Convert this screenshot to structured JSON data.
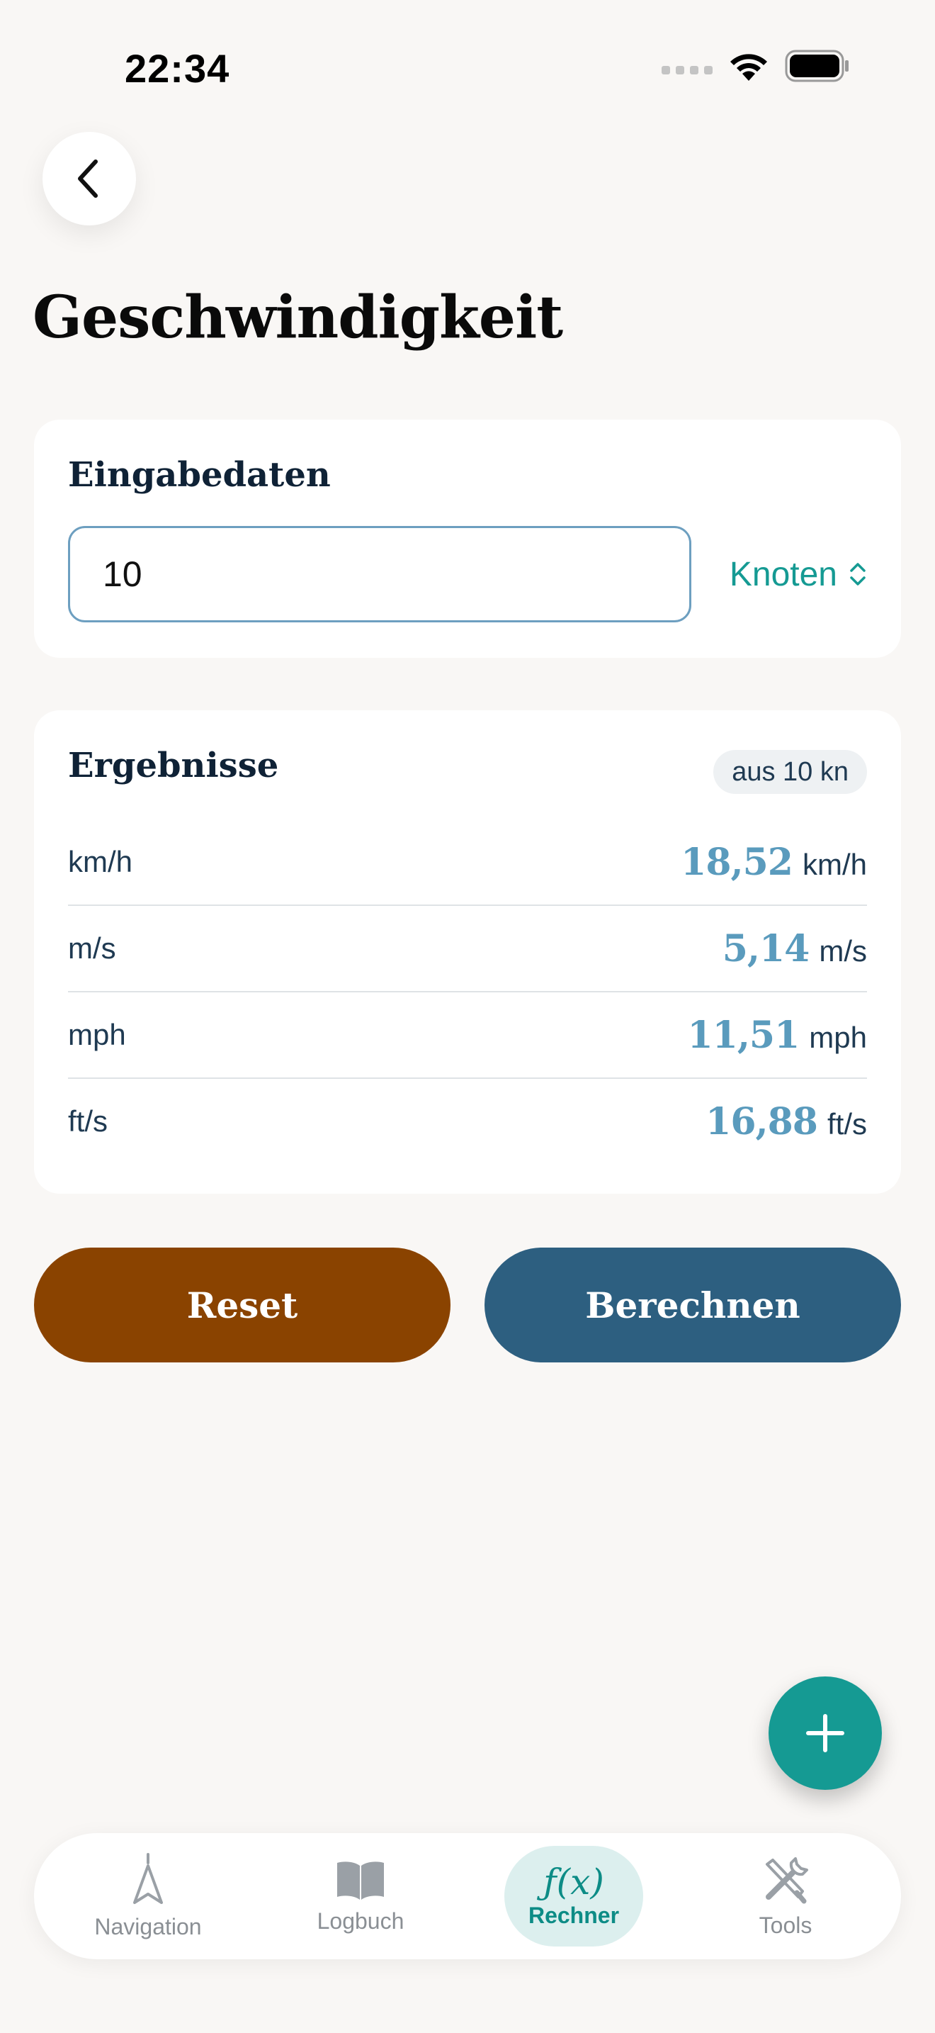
{
  "status_bar": {
    "time": "22:34"
  },
  "page": {
    "title": "Geschwindigkeit"
  },
  "input_card": {
    "heading": "Eingabedaten",
    "value": "10",
    "unit": "Knoten"
  },
  "results_card": {
    "heading": "Ergebnisse",
    "source_badge": "aus 10 kn",
    "rows": [
      {
        "label": "km/h",
        "value": "18,52",
        "unit": "km/h"
      },
      {
        "label": "m/s",
        "value": "5,14",
        "unit": "m/s"
      },
      {
        "label": "mph",
        "value": "11,51",
        "unit": "mph"
      },
      {
        "label": "ft/s",
        "value": "16,88",
        "unit": "ft/s"
      }
    ]
  },
  "actions": {
    "reset_label": "Reset",
    "calculate_label": "Berechnen"
  },
  "tab_bar": {
    "items": [
      {
        "label": "Navigation",
        "icon": "compass-arrow-icon"
      },
      {
        "label": "Logbuch",
        "icon": "book-icon"
      },
      {
        "label": "Rechner",
        "icon": "function-icon",
        "glyph": "ƒ(x)",
        "active": true
      },
      {
        "label": "Tools",
        "icon": "tools-icon"
      }
    ]
  },
  "colors": {
    "accent": "#159a93",
    "reset": "#8a4300",
    "calculate": "#2d5f80",
    "result_value": "#5a9bbd",
    "background": "#f9f7f5"
  }
}
